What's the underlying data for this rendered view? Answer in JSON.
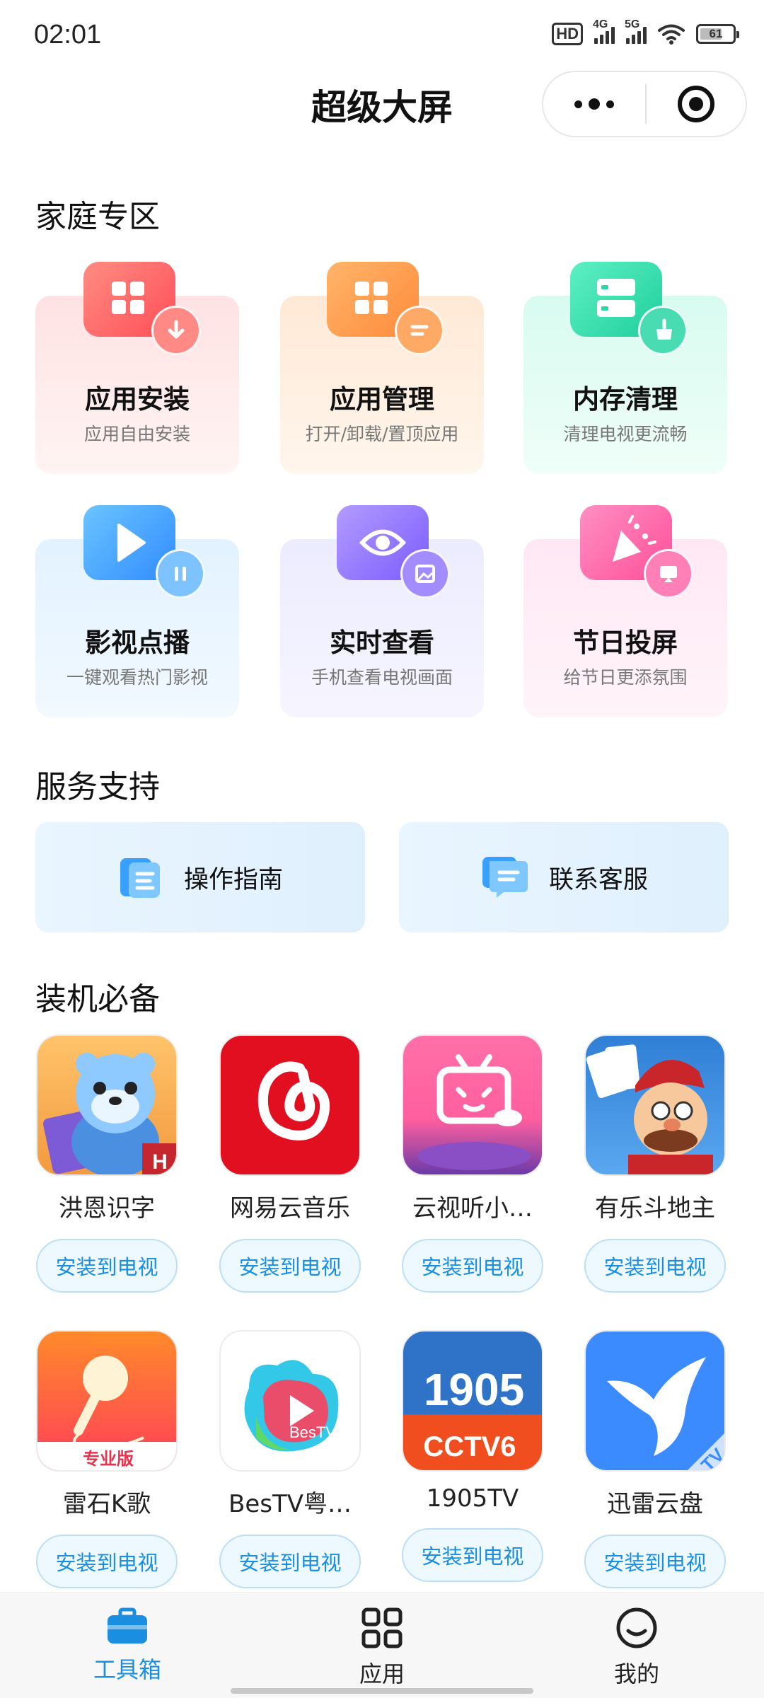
{
  "status_bar": {
    "time": "02:01",
    "hd": "HD",
    "net1": "4G",
    "net2": "5G",
    "battery": "61"
  },
  "header": {
    "title": "超级大屏"
  },
  "family_section": {
    "title": "家庭专区",
    "cards": [
      {
        "name": "应用安装",
        "desc": "应用自由安装",
        "icon": "grid-download-icon",
        "color": "#ff6a66"
      },
      {
        "name": "应用管理",
        "desc": "打开/卸载/置顶应用",
        "icon": "grid-manage-icon",
        "color": "#ff9a4a"
      },
      {
        "name": "内存清理",
        "desc": "清理电视更流畅",
        "icon": "storage-clean-icon",
        "color": "#2fd5a8"
      },
      {
        "name": "影视点播",
        "desc": "一键观看热门影视",
        "icon": "play-icon",
        "color": "#3aa6ff"
      },
      {
        "name": "实时查看",
        "desc": "手机查看电视画面",
        "icon": "eye-icon",
        "color": "#8a6cff"
      },
      {
        "name": "节日投屏",
        "desc": "给节日更添氛围",
        "icon": "party-popper-icon",
        "color": "#ff5fa4"
      }
    ]
  },
  "service_section": {
    "title": "服务支持",
    "buttons": [
      {
        "label": "操作指南",
        "icon": "guide-doc-icon"
      },
      {
        "label": "联系客服",
        "icon": "chat-service-icon"
      }
    ]
  },
  "apps_section": {
    "title": "装机必备",
    "install_label": "安装到电视",
    "apps": [
      {
        "name": "洪恩识字",
        "icon": "hongen-tiger-icon"
      },
      {
        "name": "网易云音乐",
        "icon": "netease-music-icon"
      },
      {
        "name": "云视听小…",
        "icon": "bilibili-tv-icon"
      },
      {
        "name": "有乐斗地主",
        "icon": "doudizhu-icon"
      },
      {
        "name": "雷石K歌",
        "icon": "microphone-icon",
        "badge": "专业版"
      },
      {
        "name": "BesTV粤…",
        "icon": "bestv-icon",
        "badge": "BesTV"
      },
      {
        "name": "1905TV",
        "icon": "cctv6-1905-icon",
        "badge": "1905",
        "badge2": "CCTV6"
      },
      {
        "name": "迅雷云盘",
        "icon": "thunder-bird-icon",
        "badge": "TV"
      }
    ]
  },
  "tabbar": {
    "tabs": [
      {
        "label": "工具箱",
        "icon": "toolbox-icon",
        "active": true
      },
      {
        "label": "应用",
        "icon": "apps-grid-icon",
        "active": false
      },
      {
        "label": "我的",
        "icon": "smile-face-icon",
        "active": false
      }
    ]
  },
  "colors": {
    "accent": "#1a8ee0",
    "active_tab": "#1a8ee0"
  }
}
